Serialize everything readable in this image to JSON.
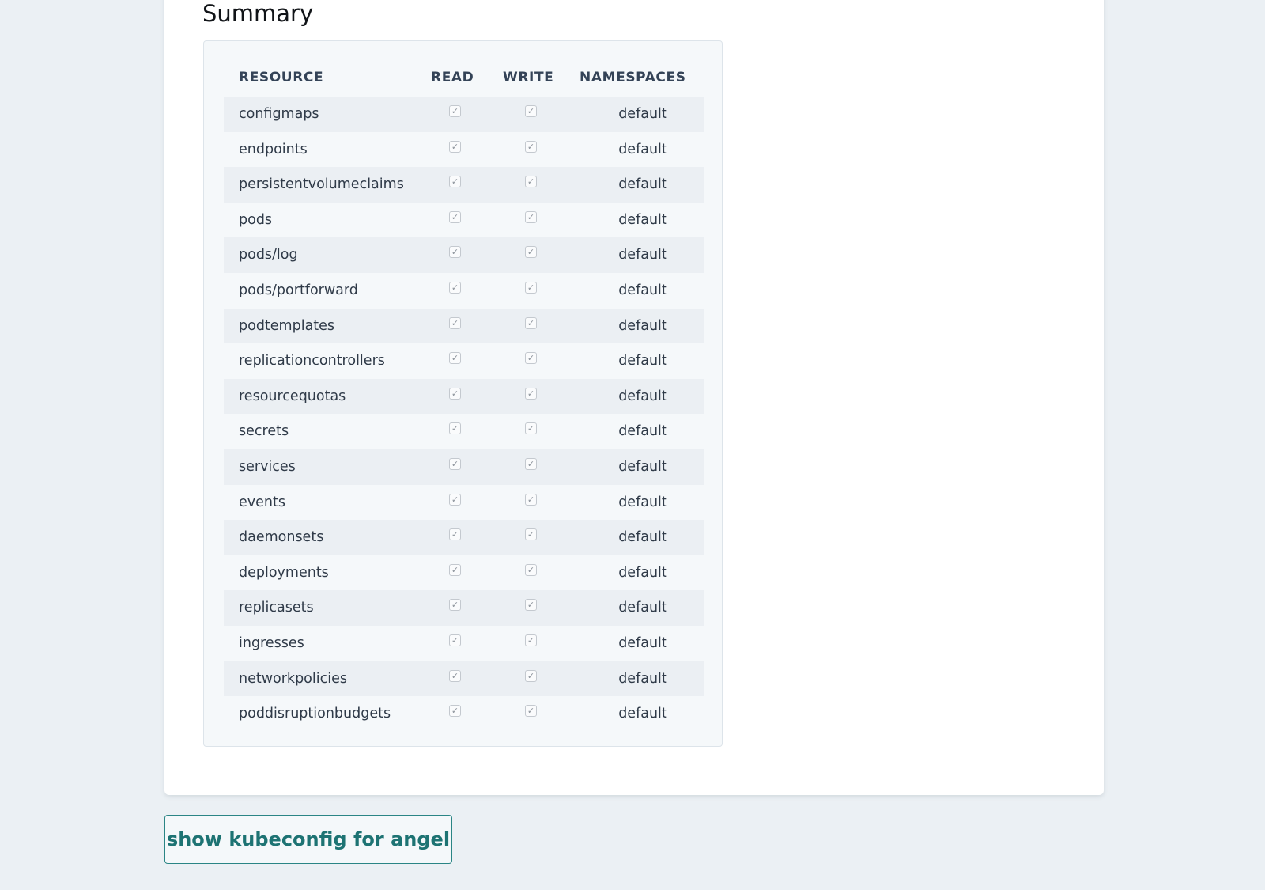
{
  "summary": {
    "title": "Summary",
    "headers": {
      "resource": "RESOURCE",
      "read": "READ",
      "write": "WRITE",
      "namespaces": "NAMESPACES"
    },
    "rows": [
      {
        "resource": "configmaps",
        "read": true,
        "write": true,
        "namespaces": "default"
      },
      {
        "resource": "endpoints",
        "read": true,
        "write": true,
        "namespaces": "default"
      },
      {
        "resource": "persistentvolumeclaims",
        "read": true,
        "write": true,
        "namespaces": "default"
      },
      {
        "resource": "pods",
        "read": true,
        "write": true,
        "namespaces": "default"
      },
      {
        "resource": "pods/log",
        "read": true,
        "write": true,
        "namespaces": "default"
      },
      {
        "resource": "pods/portforward",
        "read": true,
        "write": true,
        "namespaces": "default"
      },
      {
        "resource": "podtemplates",
        "read": true,
        "write": true,
        "namespaces": "default"
      },
      {
        "resource": "replicationcontrollers",
        "read": true,
        "write": true,
        "namespaces": "default"
      },
      {
        "resource": "resourcequotas",
        "read": true,
        "write": true,
        "namespaces": "default"
      },
      {
        "resource": "secrets",
        "read": true,
        "write": true,
        "namespaces": "default"
      },
      {
        "resource": "services",
        "read": true,
        "write": true,
        "namespaces": "default"
      },
      {
        "resource": "events",
        "read": true,
        "write": true,
        "namespaces": "default"
      },
      {
        "resource": "daemonsets",
        "read": true,
        "write": true,
        "namespaces": "default"
      },
      {
        "resource": "deployments",
        "read": true,
        "write": true,
        "namespaces": "default"
      },
      {
        "resource": "replicasets",
        "read": true,
        "write": true,
        "namespaces": "default"
      },
      {
        "resource": "ingresses",
        "read": true,
        "write": true,
        "namespaces": "default"
      },
      {
        "resource": "networkpolicies",
        "read": true,
        "write": true,
        "namespaces": "default"
      },
      {
        "resource": "poddisruptionbudgets",
        "read": true,
        "write": true,
        "namespaces": "default"
      }
    ]
  },
  "actions": {
    "kubeconfig_button": "show kubeconfig for angel"
  },
  "colors": {
    "page_background": "#ebf0f4",
    "card_background": "#ffffff",
    "table_panel": "#f5f8fa",
    "striped_row": "#ebeff3",
    "accent_teal": "#1d7373"
  },
  "icons": {
    "checkbox": "checkbox-checked-icon"
  }
}
